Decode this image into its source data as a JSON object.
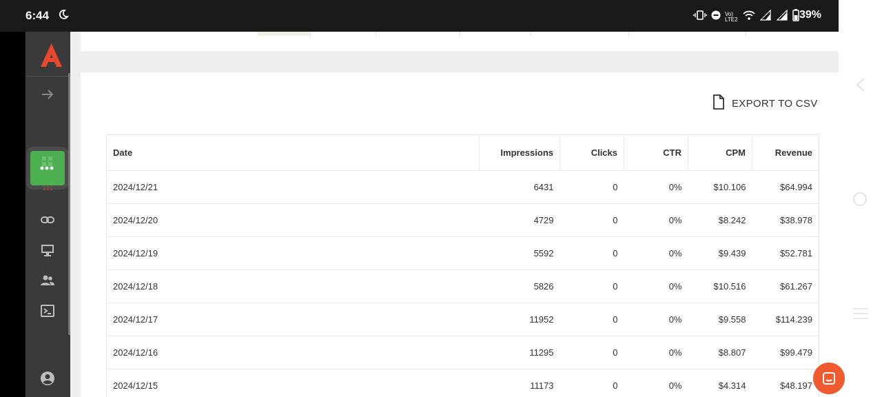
{
  "status_bar": {
    "time": "6:44",
    "network_label": "Vo) LTE2",
    "battery": "39%"
  },
  "sidebar": {
    "items": [
      {
        "icon": "arrow-right-icon"
      },
      {
        "icon": "grid-apps-icon"
      },
      {
        "icon": "bar-chart-icon"
      },
      {
        "icon": "link-icon"
      },
      {
        "icon": "monitor-icon"
      },
      {
        "icon": "users-icon"
      },
      {
        "icon": "terminal-icon"
      },
      {
        "icon": "account-icon"
      }
    ]
  },
  "main": {
    "export_label": "EXPORT TO CSV",
    "table": {
      "headers": [
        "Date",
        "Impressions",
        "Clicks",
        "CTR",
        "CPM",
        "Revenue"
      ],
      "rows": [
        {
          "date": "2024/12/21",
          "impressions": "6431",
          "clicks": "0",
          "ctr": "0%",
          "cpm": "$10.106",
          "revenue": "$64.994"
        },
        {
          "date": "2024/12/20",
          "impressions": "4729",
          "clicks": "0",
          "ctr": "0%",
          "cpm": "$8.242",
          "revenue": "$38.978"
        },
        {
          "date": "2024/12/19",
          "impressions": "5592",
          "clicks": "0",
          "ctr": "0%",
          "cpm": "$9.439",
          "revenue": "$52.781"
        },
        {
          "date": "2024/12/18",
          "impressions": "5826",
          "clicks": "0",
          "ctr": "0%",
          "cpm": "$10.516",
          "revenue": "$61.267"
        },
        {
          "date": "2024/12/17",
          "impressions": "11952",
          "clicks": "0",
          "ctr": "0%",
          "cpm": "$9.558",
          "revenue": "$114.239"
        },
        {
          "date": "2024/12/16",
          "impressions": "11295",
          "clicks": "0",
          "ctr": "0%",
          "cpm": "$8.807",
          "revenue": "$99.479"
        },
        {
          "date": "2024/12/15",
          "impressions": "11173",
          "clicks": "0",
          "ctr": "0%",
          "cpm": "$4.314",
          "revenue": "$48.197"
        }
      ]
    }
  },
  "colors": {
    "brand": "#e8482c",
    "sidebar_bg": "#3a3a3a",
    "active_item": "#4caf50",
    "chat_button": "#ef5a2f"
  }
}
